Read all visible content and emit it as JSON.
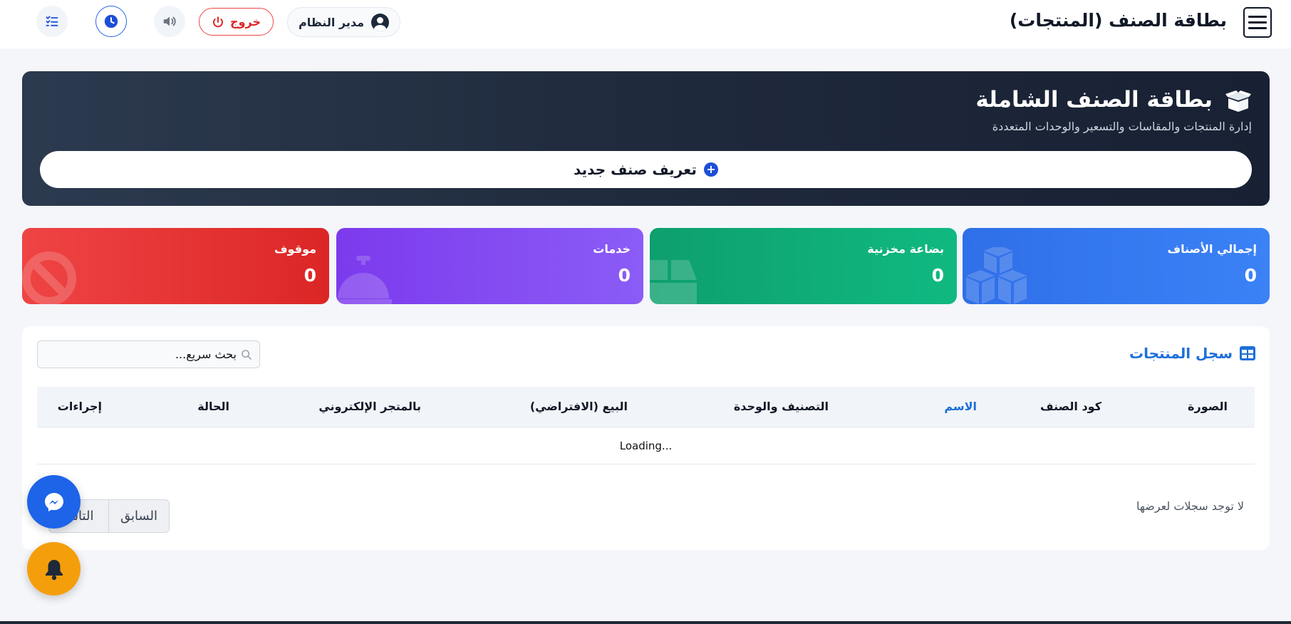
{
  "header": {
    "title": "بطاقة الصنف (المنتجات)",
    "user_label": "مدير النظام",
    "logout_label": "خروج"
  },
  "hero": {
    "title": "بطاقة الصنف الشاملة",
    "subtitle": "إدارة المنتجات والمقاسات والتسعير والوحدات المتعددة",
    "new_item_label": "تعريف صنف جديد"
  },
  "stats": [
    {
      "label": "إجمالي الأصناف",
      "value": "0",
      "color": "#3b82f6"
    },
    {
      "label": "بضاعة مخزنية",
      "value": "0",
      "color": "#10b981"
    },
    {
      "label": "خدمات",
      "value": "0",
      "color": "#8b5cf6"
    },
    {
      "label": "موقوف",
      "value": "0",
      "color": "#ef4444"
    }
  ],
  "table": {
    "title": "سجل المنتجات",
    "search_placeholder": "بحث سريع...",
    "columns": [
      "الصورة",
      "كود الصنف",
      "الاسم",
      "التصنيف والوحدة",
      "البيع (الافتراضي)",
      "بالمتجر الإلكتروني",
      "الحالة",
      "إجراءات"
    ],
    "loading_text": "Loading...",
    "empty_text": "لا توجد سجلات لعرضها",
    "prev_label": "السابق",
    "next_label": "التالي"
  },
  "colors": {
    "accent": "#1d6fd8",
    "danger": "#dc2626",
    "hero_bg": "#1f2a3c"
  }
}
